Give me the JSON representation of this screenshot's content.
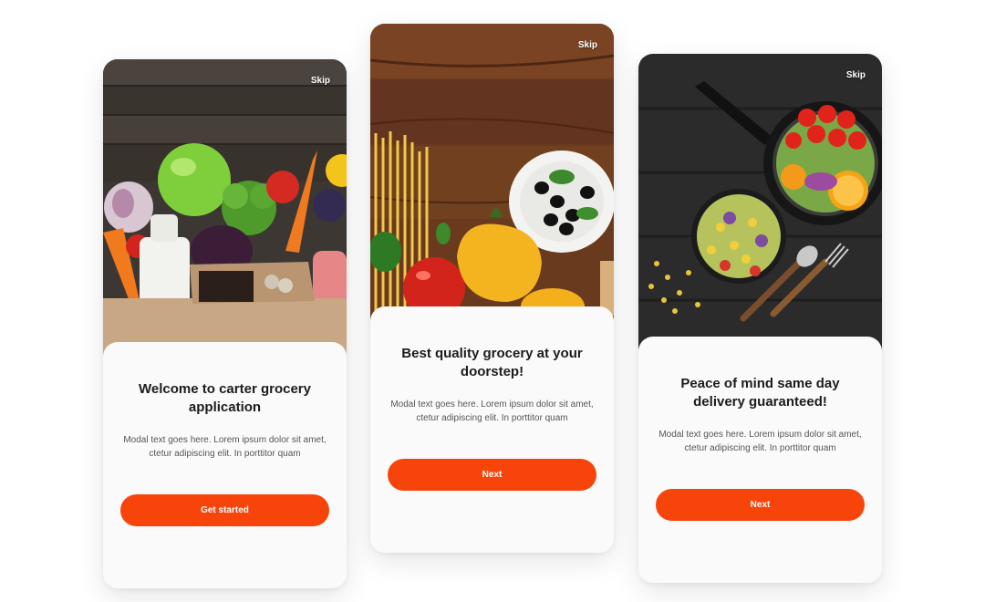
{
  "colors": {
    "accent": "#f7440b",
    "title": "#1c1c1c",
    "body": "#555555",
    "card": "#fafafa"
  },
  "screens": [
    {
      "skip_label": "Skip",
      "title": "Welcome to carter grocery application",
      "body": "Modal text goes here. Lorem ipsum dolor sit amet, ctetur adipiscing elit. In porttitor quam",
      "cta_label": "Get started"
    },
    {
      "skip_label": "Skip",
      "title": "Best quality grocery at your doorstep!",
      "body": "Modal text goes here. Lorem ipsum dolor sit amet, ctetur adipiscing elit. In porttitor quam",
      "cta_label": "Next"
    },
    {
      "skip_label": "Skip",
      "title": "Peace of mind same day delivery guaranteed!",
      "body": "Modal text goes here. Lorem ipsum dolor sit amet, ctetur adipiscing elit. In porttitor quam",
      "cta_label": "Next"
    }
  ]
}
